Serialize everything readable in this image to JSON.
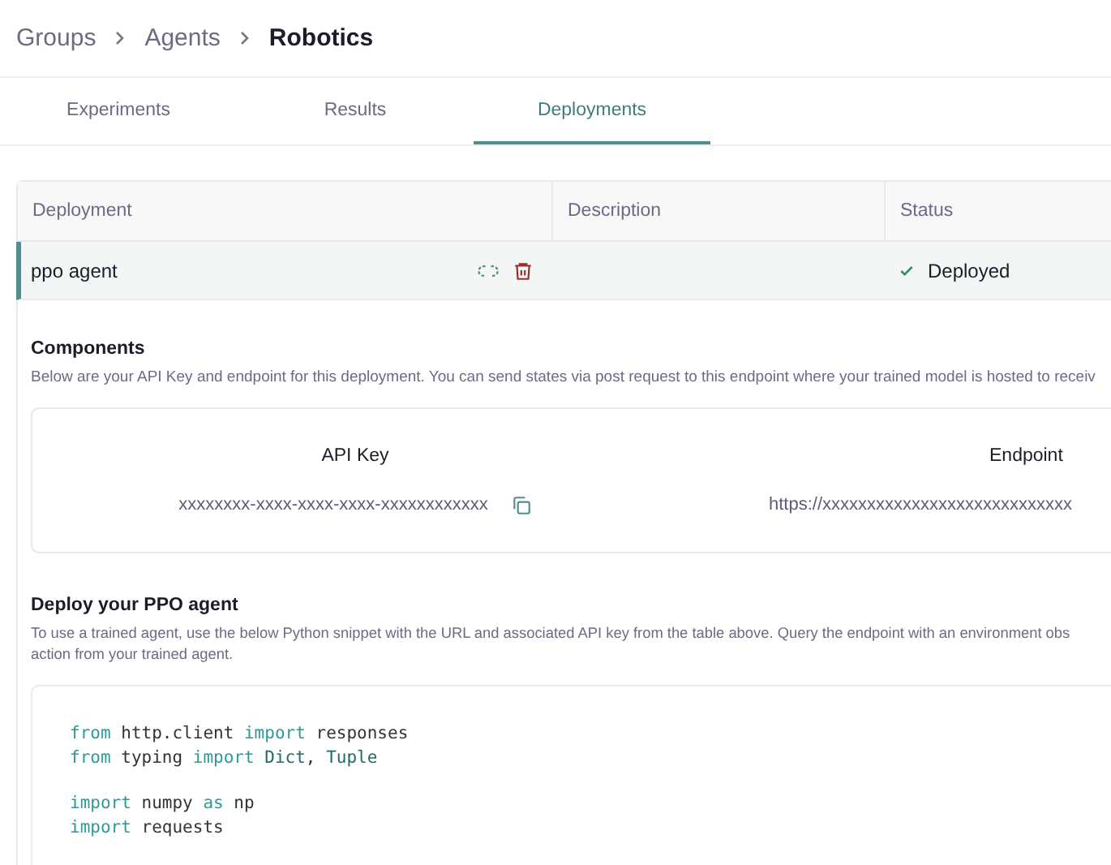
{
  "breadcrumb": [
    {
      "label": "Groups",
      "current": false
    },
    {
      "label": "Agents",
      "current": false
    },
    {
      "label": "Robotics",
      "current": true
    }
  ],
  "tabs": [
    {
      "label": "Experiments",
      "selected": false
    },
    {
      "label": "Results",
      "selected": false
    },
    {
      "label": "Deployments",
      "selected": true
    }
  ],
  "table": {
    "columns": [
      "Deployment",
      "Description",
      "Status"
    ],
    "rows": [
      {
        "name": "ppo agent",
        "description": "",
        "status": "Deployed",
        "selected": true,
        "expanded": true
      }
    ]
  },
  "components": {
    "title": "Components",
    "description": "Below are your API Key and endpoint for this deployment. You can send states via post request to this endpoint where your trained model is hosted to receiv",
    "items": [
      {
        "label": "API Key",
        "value": "xxxxxxxx-xxxx-xxxx-xxxx-xxxxxxxxxxxx",
        "copyable": true
      },
      {
        "label": "Endpoint",
        "value": "https://xxxxxxxxxxxxxxxxxxxxxxxxxxxx",
        "copyable": false
      }
    ]
  },
  "deploy": {
    "title": "Deploy your PPO agent",
    "description_lines": [
      "To use a trained agent, use the below Python snippet with the URL and associated API key from the table above. Query the endpoint with an environment obs",
      "action from your trained agent."
    ],
    "code_blocks": [
      [
        [
          {
            "kind": "keyword",
            "text": "from"
          },
          {
            "kind": "plain",
            "text": " http.client "
          },
          {
            "kind": "keyword",
            "text": "import"
          },
          {
            "kind": "plain",
            "text": " responses"
          }
        ],
        [
          {
            "kind": "keyword",
            "text": "from"
          },
          {
            "kind": "plain",
            "text": " typing "
          },
          {
            "kind": "keyword",
            "text": "import"
          },
          {
            "kind": "type",
            "text": " Dict"
          },
          {
            "kind": "plain",
            "text": ", "
          },
          {
            "kind": "type",
            "text": "Tuple"
          }
        ]
      ],
      [
        [
          {
            "kind": "keyword",
            "text": "import"
          },
          {
            "kind": "plain",
            "text": " numpy "
          },
          {
            "kind": "keyword",
            "text": "as"
          },
          {
            "kind": "plain",
            "text": " np"
          }
        ],
        [
          {
            "kind": "keyword",
            "text": "import"
          },
          {
            "kind": "plain",
            "text": " requests"
          }
        ]
      ]
    ]
  }
}
